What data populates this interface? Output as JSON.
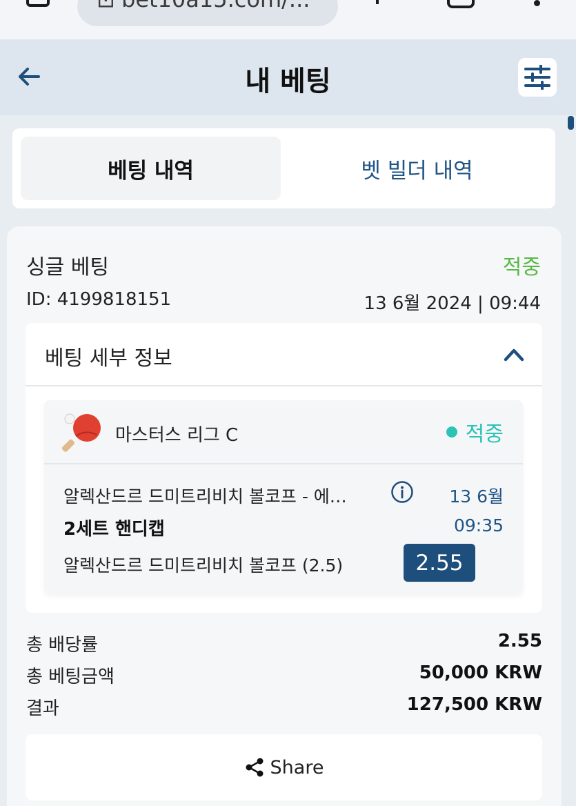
{
  "browser": {
    "url_text": "bet10a15.com/..."
  },
  "header": {
    "title": "내 베팅"
  },
  "tabs": {
    "active_label": "베팅 내역",
    "inactive_label": "벳 빌더 내역"
  },
  "bet": {
    "type": "싱글 베팅",
    "status": "적중",
    "id_text": "ID: 4199818151",
    "datetime": "13 6월 2024 | 09:44",
    "details_title": "베팅 세부 정보",
    "selection": {
      "league": "마스터스 리그 C",
      "status": "적중",
      "match": "알렉산드르 드미트리비치 볼코프 - 에…",
      "date": "13 6월",
      "time": "09:35",
      "market": "2세트 핸디캡",
      "pick": "알렉산드르 드미트리비치 볼코프 (2.5)",
      "odds": "2.55"
    },
    "summary": {
      "total_odds_label": "총 배당률",
      "total_odds_value": "2.55",
      "total_stake_label": "총 베팅금액",
      "total_stake_value": "50,000 KRW",
      "result_label": "결과",
      "result_value": "127,500 KRW"
    },
    "share_label": "Share"
  },
  "colors": {
    "accent": "#1d4e7c",
    "won_green": "#58b946",
    "won_teal": "#2cc2b6"
  }
}
